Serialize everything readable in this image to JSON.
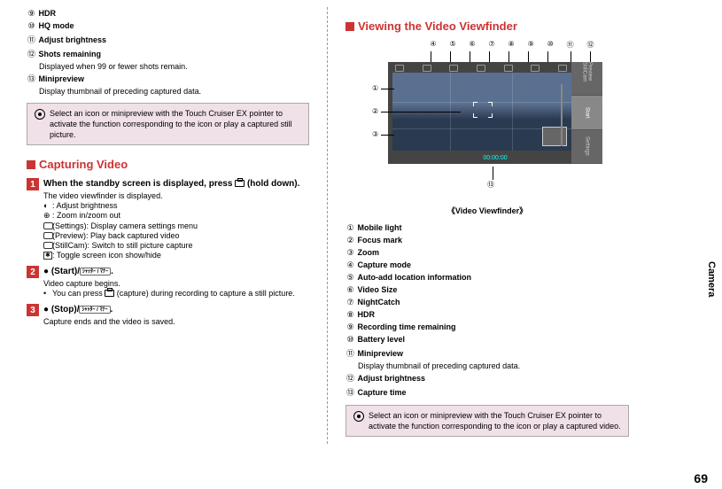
{
  "page_number": "69",
  "side_tab": "Camera",
  "left": {
    "items_top": [
      {
        "n": "⑨",
        "label": "HDR"
      },
      {
        "n": "⑩",
        "label": "HQ mode"
      },
      {
        "n": "⑪",
        "label": "Adjust brightness"
      },
      {
        "n": "⑫",
        "label": "Shots remaining",
        "desc": "Displayed when 99 or fewer shots remain."
      },
      {
        "n": "⑬",
        "label": "Minipreview",
        "desc": "Display thumbnail of preceding captured data."
      }
    ],
    "note1": "Select an icon or minipreview with the Touch Cruiser EX pointer to activate the function corresponding to the icon or play a captured still picture.",
    "section1_title": "Capturing Video",
    "step1_head_a": "When the standby screen is displayed, press ",
    "step1_head_b": " (hold down).",
    "step1_desc": "The video viewfinder is displayed.",
    "step1_bullets": [
      {
        "sym": "◐",
        "txt": ": Adjust brightness"
      },
      {
        "sym": "⊕",
        "txt": ": Zoom in/zoom out"
      },
      {
        "sym": "▭",
        "txt": " (Settings): Display camera settings menu"
      },
      {
        "sym": "◙",
        "txt": " (Preview): Play back captured video"
      },
      {
        "sym": "◉",
        "txt": " (StillCam): Switch to still picture capture"
      },
      {
        "sym": "✱",
        "txt": ": Toggle screen icon show/hide"
      }
    ],
    "step2_head": "● (Start)/",
    "step2_btn": "ｼｬｯﾀｰ / ﾏﾅｰ",
    "step2_end": ".",
    "step2_desc": "Video capture begins.",
    "step2_sub_a": "You can press ",
    "step2_sub_b": " (capture) during recording to capture a still picture.",
    "step3_head": "● (Stop)/",
    "step3_btn": "ｼｬｯﾀｰ / ﾏﾅｰ",
    "step3_end": ".",
    "step3_desc": "Capture ends and the video is saved."
  },
  "right": {
    "section_title": "Viewing the Video Viewfinder",
    "top_nums": [
      "④",
      "⑤",
      "⑥",
      "⑦",
      "⑧",
      "⑨",
      "⑩",
      "⑪",
      "⑫"
    ],
    "left_nums": [
      "①",
      "②",
      "③"
    ],
    "bottom_num": "⑬",
    "vf_caption": "《Video Viewfinder》",
    "vf_timer": "00:00:00",
    "side_preview": "Preview StillCam",
    "side_start": "Start",
    "side_settings": "Settings",
    "items": [
      {
        "n": "①",
        "label": "Mobile light"
      },
      {
        "n": "②",
        "label": "Focus mark"
      },
      {
        "n": "③",
        "label": "Zoom"
      },
      {
        "n": "④",
        "label": "Capture mode"
      },
      {
        "n": "⑤",
        "label": "Auto-add location information"
      },
      {
        "n": "⑥",
        "label": "Video Size"
      },
      {
        "n": "⑦",
        "label": "NightCatch"
      },
      {
        "n": "⑧",
        "label": "HDR"
      },
      {
        "n": "⑨",
        "label": "Recording time remaining"
      },
      {
        "n": "⑩",
        "label": "Battery level"
      },
      {
        "n": "⑪",
        "label": "Minipreview",
        "desc": "Display thumbnail of preceding captured data."
      },
      {
        "n": "⑫",
        "label": "Adjust brightness"
      },
      {
        "n": "⑬",
        "label": "Capture time"
      }
    ],
    "note": "Select an icon or minipreview with the Touch Cruiser EX pointer to activate the function corresponding to the icon or play a captured video."
  }
}
